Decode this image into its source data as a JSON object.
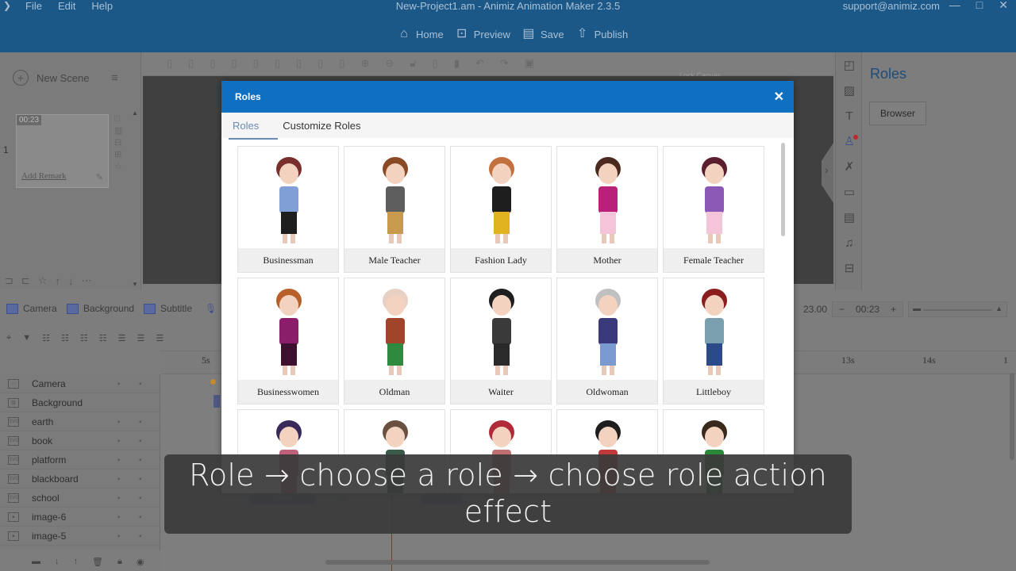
{
  "window": {
    "title": "New-Project1.am - Animiz Animation Maker 2.3.5",
    "support_email": "support@animiz.com",
    "menu": [
      "File",
      "Edit",
      "Help"
    ],
    "controls": {
      "minimize": "—",
      "maximize": "□",
      "close": "✕"
    }
  },
  "main_toolbar": [
    {
      "label": "Home",
      "icon": "home-icon"
    },
    {
      "label": "Preview",
      "icon": "preview-icon"
    },
    {
      "label": "Save",
      "icon": "save-icon"
    },
    {
      "label": "Publish",
      "icon": "publish-icon"
    }
  ],
  "edit_toolbar": {
    "lock_canvas_label": "Lock Canvas"
  },
  "scene_panel": {
    "new_scene_label": "New Scene",
    "scene_number": "1",
    "scene_duration": "00:23",
    "add_remark_label": "Add Remark"
  },
  "right_panel": {
    "title": "Roles",
    "browser_button": "Browser"
  },
  "track_toolbar": {
    "items": [
      "Camera",
      "Background",
      "Subtitle",
      "R"
    ]
  },
  "time_control": {
    "current_time": "23.00",
    "duration": "00:23",
    "minus": "−",
    "plus": "+"
  },
  "ruler": {
    "ticks": [
      "5s",
      "13s",
      "14s",
      "1"
    ]
  },
  "layers": [
    {
      "name": "Camera",
      "type": "camera"
    },
    {
      "name": "Background",
      "type": "background"
    },
    {
      "name": "earth",
      "type": "svg"
    },
    {
      "name": "book",
      "type": "svg"
    },
    {
      "name": "platform",
      "type": "svg"
    },
    {
      "name": "blackboard",
      "type": "svg"
    },
    {
      "name": "school",
      "type": "svg"
    },
    {
      "name": "image-6",
      "type": "image"
    },
    {
      "name": "image-5",
      "type": "image"
    }
  ],
  "timeline": {
    "key_label": "None"
  },
  "modal": {
    "title": "Roles",
    "close": "✕",
    "tabs": [
      {
        "label": "Roles",
        "active": true
      },
      {
        "label": "Customize Roles",
        "active": false
      }
    ],
    "roles": [
      {
        "name": "Businessman",
        "hair": "#7a2e2e",
        "top": "#7f9fd6",
        "bottom": "#1e1e1e"
      },
      {
        "name": "Male Teacher",
        "hair": "#8a4a25",
        "top": "#5e5e5e",
        "bottom": "#c79a4e"
      },
      {
        "name": "Fashion Lady",
        "hair": "#c2703e",
        "top": "#1e1e1e",
        "bottom": "#e2b321"
      },
      {
        "name": "Mother",
        "hair": "#4a2a1e",
        "top": "#b8207a",
        "bottom": "#f4c4d8"
      },
      {
        "name": "Female Teacher",
        "hair": "#5a1e2e",
        "top": "#8a58b5",
        "bottom": "#f4c4d8"
      },
      {
        "name": "Businesswomen",
        "hair": "#b8602a",
        "top": "#8a1e6a",
        "bottom": "#3e1030"
      },
      {
        "name": "Oldman",
        "hair": "#e8d0c4",
        "top": "#a0452a",
        "bottom": "#2e8a3e"
      },
      {
        "name": "Waiter",
        "hair": "#1e1e1e",
        "top": "#3a3a3a",
        "bottom": "#2a2a2a"
      },
      {
        "name": "Oldwoman",
        "hair": "#c0c0c0",
        "top": "#3a3a7a",
        "bottom": "#7a9ad0"
      },
      {
        "name": "Littleboy",
        "hair": "#8a1e1e",
        "top": "#7aa0b0",
        "bottom": "#2a4a8a"
      },
      {
        "name": "",
        "hair": "#3a2a5a",
        "top": "#c0607a",
        "bottom": "#c0607a"
      },
      {
        "name": "",
        "hair": "#6a5040",
        "top": "#3a5a4a",
        "bottom": "#3a5a4a"
      },
      {
        "name": "",
        "hair": "#b02a3a",
        "top": "#c07070",
        "bottom": "#c07070"
      },
      {
        "name": "",
        "hair": "#1e1e1e",
        "top": "#c03a3a",
        "bottom": "#c03a3a"
      },
      {
        "name": "",
        "hair": "#3a2a1e",
        "top": "#2a8a3a",
        "bottom": "#2a8a3a"
      }
    ]
  },
  "caption": {
    "line1": "Role → choose a role → choose role action",
    "line2": "effect"
  }
}
